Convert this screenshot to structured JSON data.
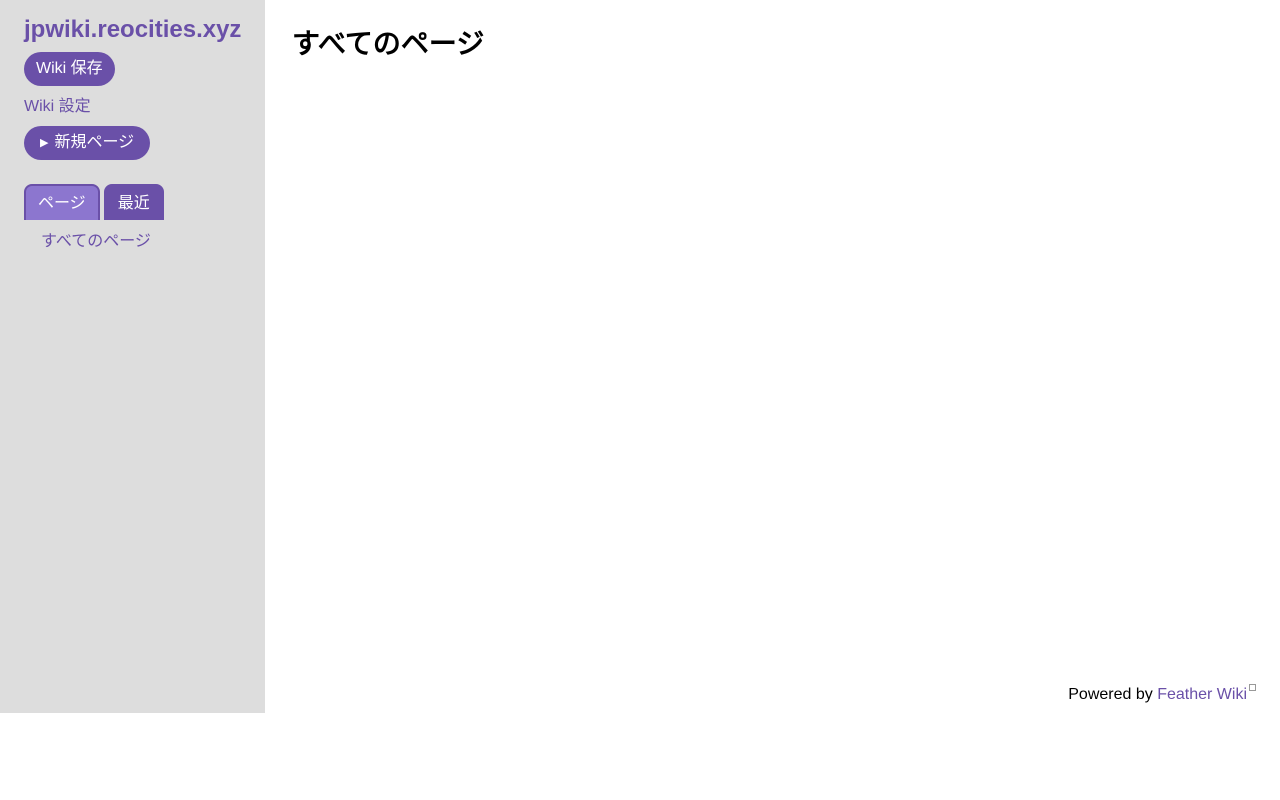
{
  "sidebar": {
    "site_title": "jpwiki.reocities.xyz",
    "save_button": "Wiki 保存",
    "settings_link": "Wiki 設定",
    "new_page_button": "新規ページ",
    "new_page_icon": "play-triangle-icon",
    "tabs": [
      {
        "label": "ページ",
        "active": true
      },
      {
        "label": "最近",
        "active": false
      }
    ],
    "page_list": [
      {
        "label": "すべてのページ"
      }
    ]
  },
  "main": {
    "title": "すべてのページ"
  },
  "footer": {
    "powered_by": "Powered by",
    "link_label": "Feather Wiki",
    "link_icon": "external-link-icon"
  },
  "colors": {
    "accent": "#6a50a8",
    "tab_active": "#8c76cf",
    "sidebar_bg": "#dddddd"
  }
}
